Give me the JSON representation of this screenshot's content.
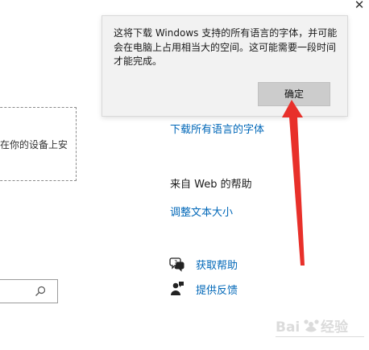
{
  "window": {
    "close_glyph": "✕"
  },
  "popup": {
    "message": "这将下载 Windows 支持的所有语言的字体，并可能会在电脑上占用相当大的空间。这可能需要一段时间才能完成。",
    "ok_label": "确定"
  },
  "left_panel": {
    "dashed_text": "在你的设备上安"
  },
  "right_panel": {
    "download_all_fonts_link": "下载所有语言的字体",
    "web_help_heading": "来自 Web 的帮助",
    "adjust_text_size_link": "调整文本大小",
    "get_help_link": "获取帮助",
    "feedback_link": "提供反馈"
  },
  "icons": {
    "search": "search-icon",
    "help": "chat-help-icon",
    "feedback": "feedback-person-icon"
  },
  "colors": {
    "link": "#0067b8",
    "arrow": "#e8302a",
    "popup_bg": "#f2f2f2",
    "button_bg": "#cccccc"
  }
}
